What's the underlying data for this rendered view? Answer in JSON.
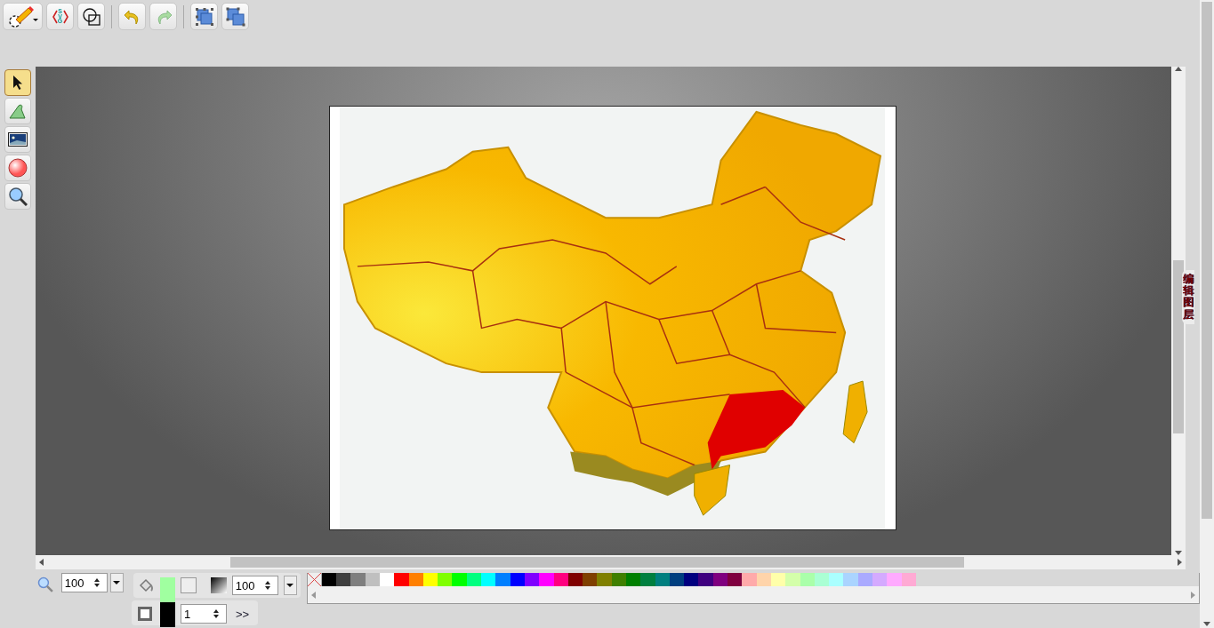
{
  "toolbar": [
    {
      "kind": "logo"
    },
    {
      "kind": "svg",
      "label": "SVG"
    },
    {
      "kind": "shapes"
    },
    {
      "kind": "undo"
    },
    {
      "kind": "redo"
    },
    {
      "kind": "group"
    },
    {
      "kind": "clone"
    }
  ],
  "tools": [
    {
      "kind": "select",
      "selected": true
    },
    {
      "kind": "path",
      "selected": false
    },
    {
      "kind": "image",
      "selected": false
    },
    {
      "kind": "ellipse",
      "selected": false
    },
    {
      "kind": "zoom",
      "selected": false
    }
  ],
  "layers_tab": "编辑图层",
  "zoom": {
    "value": "100"
  },
  "opacity": {
    "value": "100"
  },
  "stroke_width": {
    "value": "1"
  },
  "more_button": ">>",
  "paint": [
    {
      "kind": "fill",
      "color": "#a0ffa0"
    },
    {
      "kind": "stroke",
      "color": "#000000"
    }
  ],
  "palette": [
    {
      "kind": "none"
    },
    {
      "color": "#000000"
    },
    {
      "color": "#3f3f3f"
    },
    {
      "color": "#7f7f7f"
    },
    {
      "color": "#bfbfbf"
    },
    {
      "color": "#ffffff"
    },
    {
      "color": "#ff0000"
    },
    {
      "color": "#ff7f00"
    },
    {
      "color": "#ffff00"
    },
    {
      "color": "#7fff00"
    },
    {
      "color": "#00ff00"
    },
    {
      "color": "#00ff7f"
    },
    {
      "color": "#00ffff"
    },
    {
      "color": "#007fff"
    },
    {
      "color": "#0000ff"
    },
    {
      "color": "#7f00ff"
    },
    {
      "color": "#ff00ff"
    },
    {
      "color": "#ff007f"
    },
    {
      "color": "#7f0000"
    },
    {
      "color": "#7f3f00"
    },
    {
      "color": "#7f7f00"
    },
    {
      "color": "#3f7f00"
    },
    {
      "color": "#007f00"
    },
    {
      "color": "#007f3f"
    },
    {
      "color": "#007f7f"
    },
    {
      "color": "#003f7f"
    },
    {
      "color": "#00007f"
    },
    {
      "color": "#3f007f"
    },
    {
      "color": "#7f007f"
    },
    {
      "color": "#7f003f"
    },
    {
      "color": "#ffaaaa"
    },
    {
      "color": "#ffd4aa"
    },
    {
      "color": "#ffffaa"
    },
    {
      "color": "#d4ffaa"
    },
    {
      "color": "#aaffaa"
    },
    {
      "color": "#aaffd4"
    },
    {
      "color": "#aaffff"
    },
    {
      "color": "#aad4ff"
    },
    {
      "color": "#aaaaff"
    },
    {
      "color": "#d4aaff"
    },
    {
      "color": "#ffaaff"
    },
    {
      "color": "#ffaad4"
    }
  ]
}
